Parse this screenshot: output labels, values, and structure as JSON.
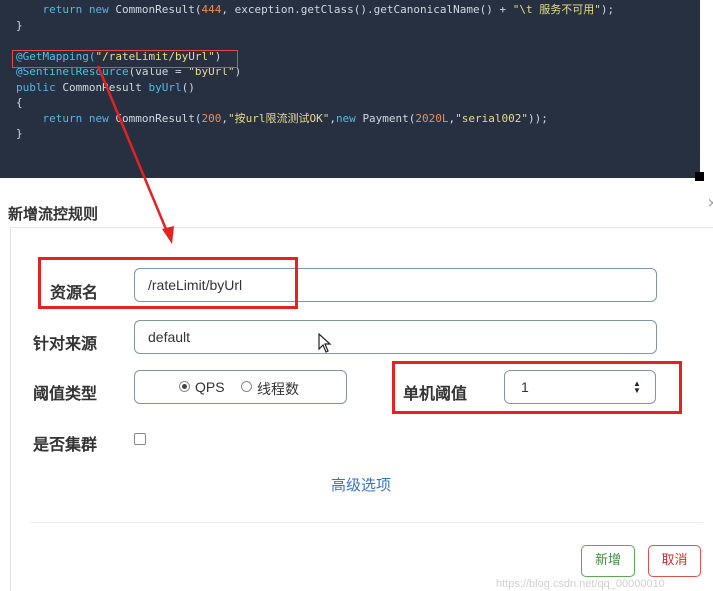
{
  "code": {
    "lines": [
      [
        {
          "t": "    "
        },
        {
          "t": "return new ",
          "c": "kw"
        },
        {
          "t": "CommonResult("
        },
        {
          "t": "444",
          "c": "num"
        },
        {
          "t": ", exception.getClass().getCanonicalName() + "
        },
        {
          "t": "\"\\t 服务不可用\"",
          "c": "str"
        },
        {
          "t": ");"
        }
      ],
      [
        {
          "t": "}"
        }
      ],
      [
        {
          "t": ""
        }
      ],
      [
        {
          "t": "@GetMapping(",
          "c": "ann"
        },
        {
          "t": "\"/rateLimit/byUrl\"",
          "c": "str"
        },
        {
          "t": ")"
        }
      ],
      [
        {
          "t": "@SentinelResource",
          "c": "ann"
        },
        {
          "t": "(value = "
        },
        {
          "t": "\"byUrl\"",
          "c": "str"
        },
        {
          "t": ")"
        }
      ],
      [
        {
          "t": "public ",
          "c": "kw"
        },
        {
          "t": "CommonResult "
        },
        {
          "t": "byUrl",
          "c": "ann"
        },
        {
          "t": "()"
        }
      ],
      [
        {
          "t": "{"
        }
      ],
      [
        {
          "t": "    "
        },
        {
          "t": "return new ",
          "c": "kw"
        },
        {
          "t": "CommonResult("
        },
        {
          "t": "200",
          "c": "num"
        },
        {
          "t": ","
        },
        {
          "t": "\"按url限流测试OK\"",
          "c": "str"
        },
        {
          "t": ","
        },
        {
          "t": "new ",
          "c": "kw"
        },
        {
          "t": "Payment("
        },
        {
          "t": "2020L",
          "c": "num"
        },
        {
          "t": ","
        },
        {
          "t": "\"serial002\"",
          "c": "str"
        },
        {
          "t": "));"
        }
      ],
      [
        {
          "t": "}"
        }
      ]
    ]
  },
  "modal": {
    "title": "新增流控规则",
    "close": "×",
    "fields": {
      "resource_label": "资源名",
      "resource_value": "/rateLimit/byUrl",
      "origin_label": "针对来源",
      "origin_value": "default",
      "threshold_type_label": "阈值类型",
      "threshold_type_options": [
        "QPS",
        "线程数"
      ],
      "threshold_type_selected": "QPS",
      "single_threshold_label": "单机阈值",
      "single_threshold_value": "1",
      "cluster_label": "是否集群",
      "cluster_checked": false
    },
    "advanced_link": "高级选项",
    "buttons": {
      "add": "新增",
      "cancel": "取消"
    }
  },
  "watermark": "https://blog.csdn.net/qq_00000010",
  "colors": {
    "highlight": "#e32222",
    "code_bg": "#263040",
    "link": "#3a74c6",
    "add_button": "#5aa65a",
    "cancel_button": "#d9534f"
  },
  "icons": {
    "spinner": "up-down-arrows-icon",
    "cursor": "mouse-pointer-icon",
    "arrow": "red-annotation-arrow"
  }
}
